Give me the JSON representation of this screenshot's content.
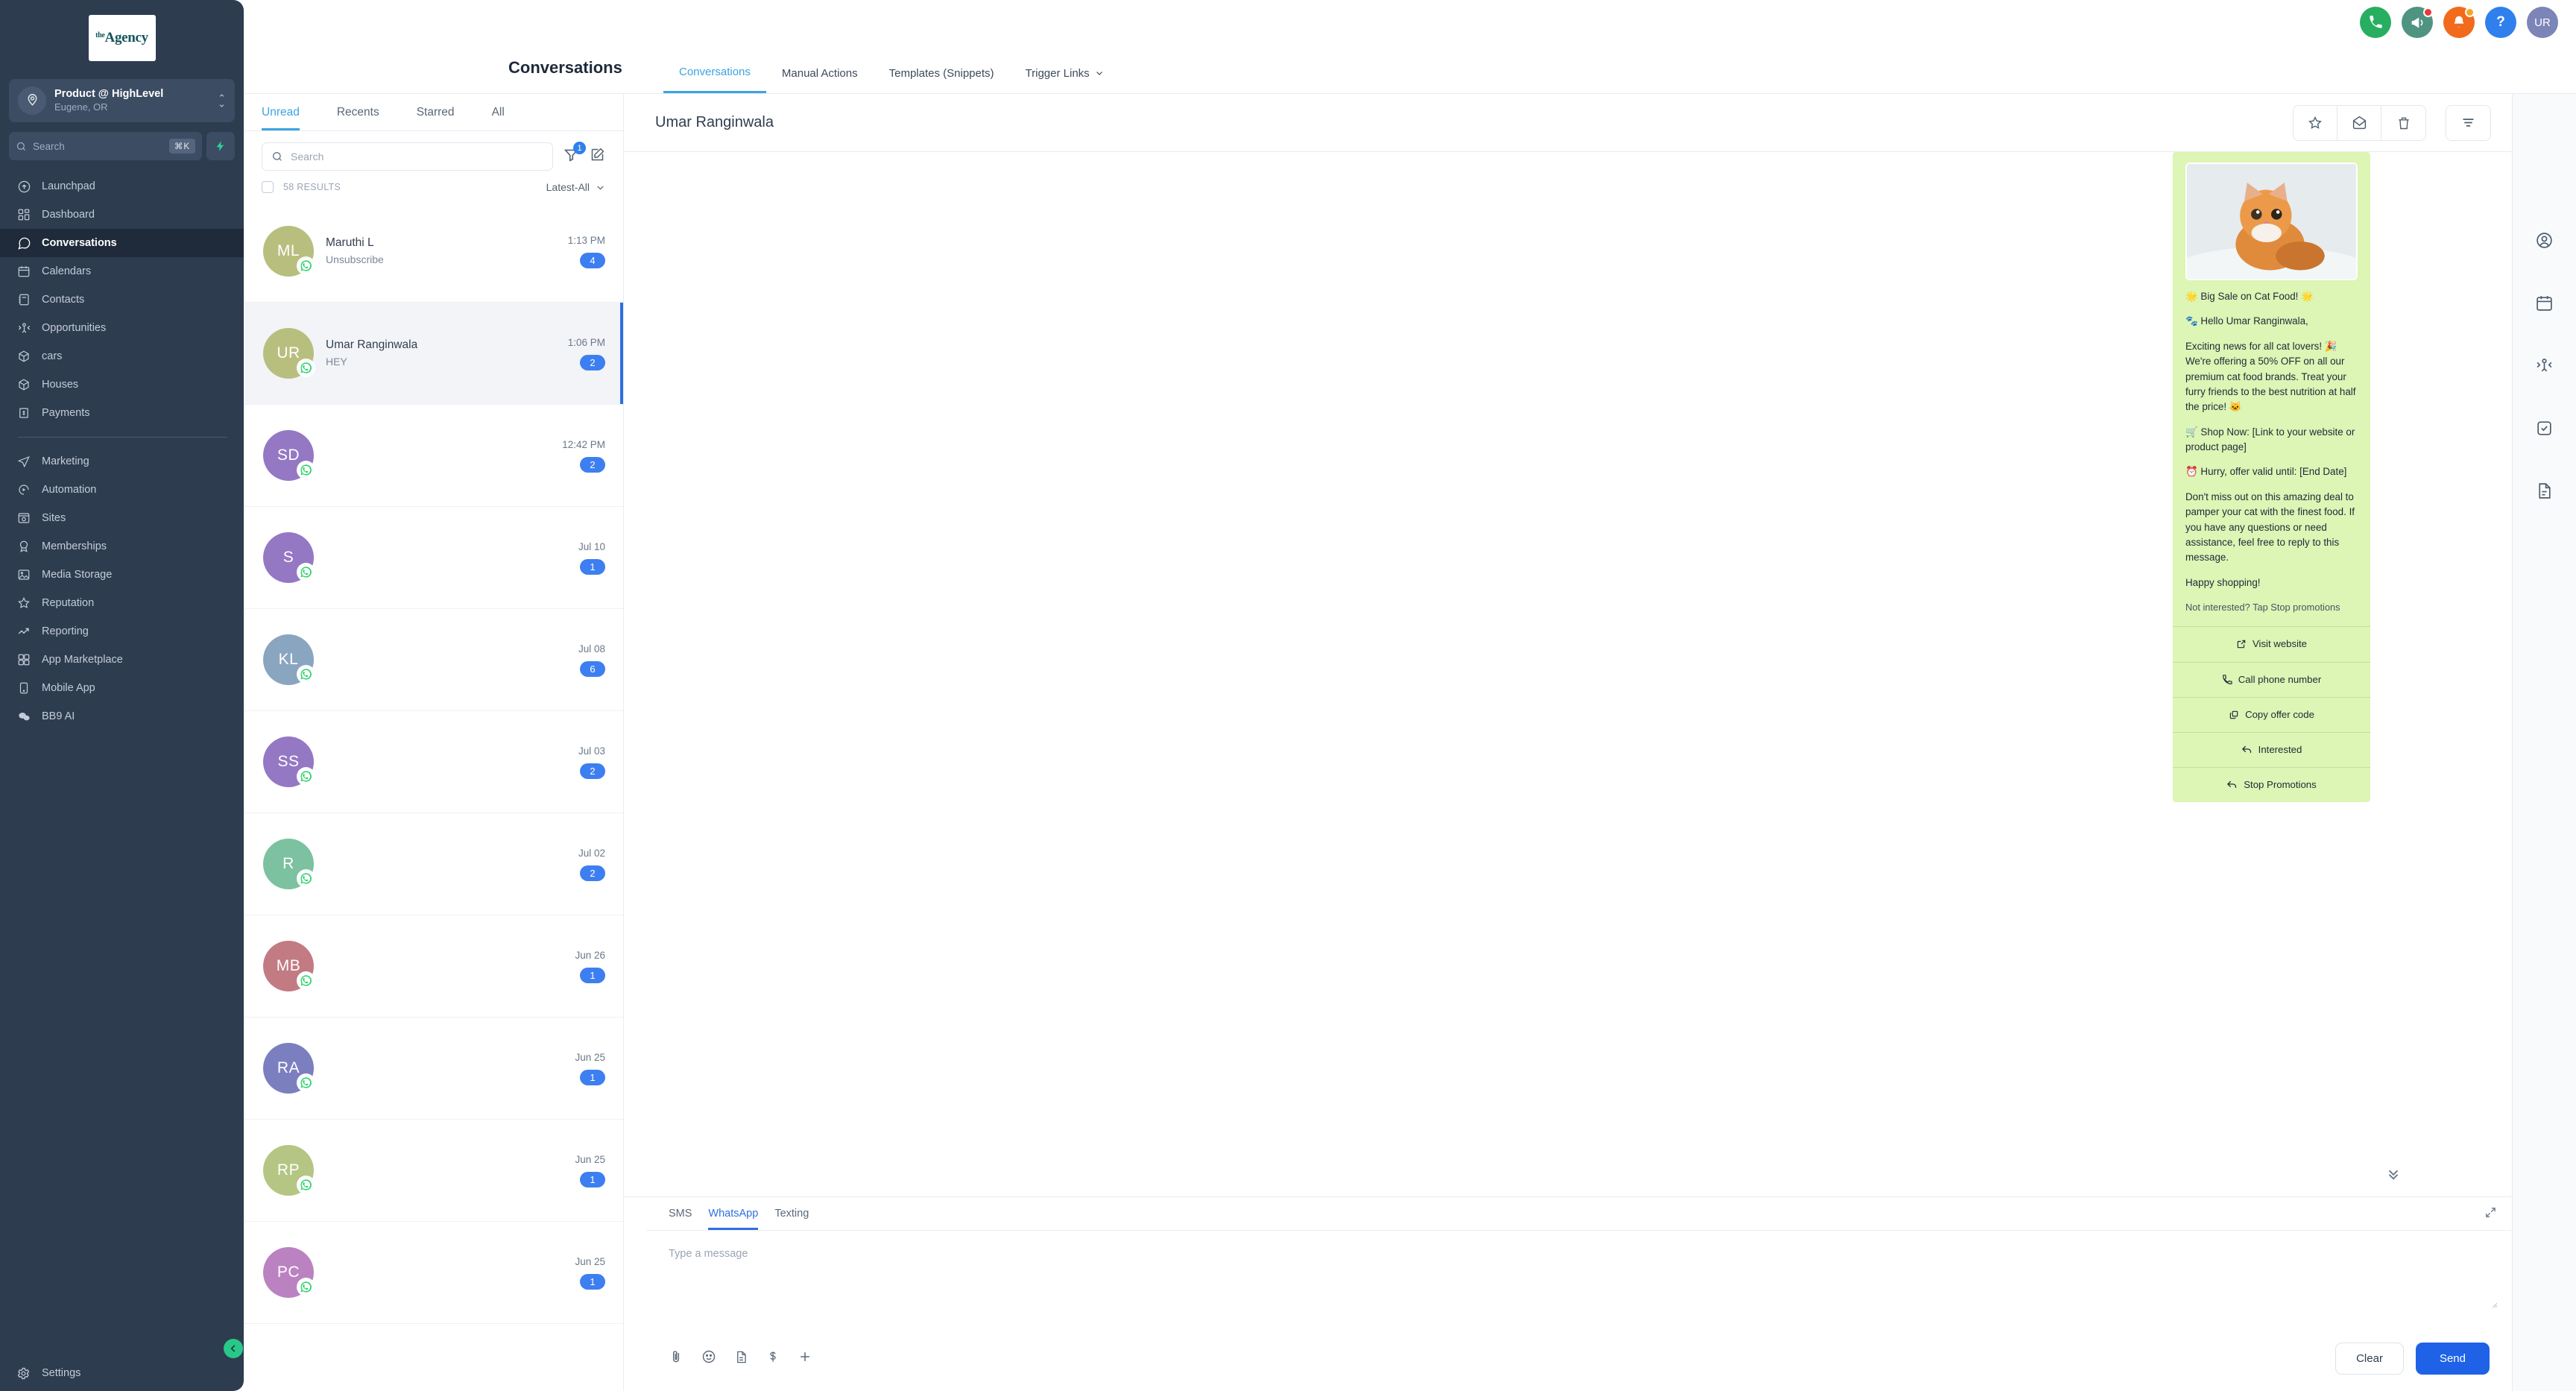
{
  "sidebar": {
    "logo": {
      "pre": "the",
      "main": "Agency"
    },
    "location": {
      "name": "Product @ HighLevel",
      "sub": "Eugene, OR"
    },
    "search": {
      "placeholder": "Search",
      "shortcut": "⌘K"
    },
    "items": [
      {
        "label": "Launchpad",
        "icon": "rocket-icon",
        "active": false
      },
      {
        "label": "Dashboard",
        "icon": "dashboard-icon",
        "active": false
      },
      {
        "label": "Conversations",
        "icon": "chat-icon",
        "active": true
      },
      {
        "label": "Calendars",
        "icon": "calendar-icon",
        "active": false
      },
      {
        "label": "Contacts",
        "icon": "contacts-icon",
        "active": false
      },
      {
        "label": "Opportunities",
        "icon": "opportunities-icon",
        "active": false
      },
      {
        "label": "cars",
        "icon": "box-icon",
        "active": false
      },
      {
        "label": "Houses",
        "icon": "box-icon",
        "active": false
      },
      {
        "label": "Payments",
        "icon": "payments-icon",
        "active": false
      }
    ],
    "items2": [
      {
        "label": "Marketing",
        "icon": "send-icon"
      },
      {
        "label": "Automation",
        "icon": "automation-icon"
      },
      {
        "label": "Sites",
        "icon": "sites-icon"
      },
      {
        "label": "Memberships",
        "icon": "badge-icon"
      },
      {
        "label": "Media Storage",
        "icon": "image-icon"
      },
      {
        "label": "Reputation",
        "icon": "star-icon"
      },
      {
        "label": "Reporting",
        "icon": "trend-icon"
      },
      {
        "label": "App Marketplace",
        "icon": "grid-icon"
      },
      {
        "label": "Mobile App",
        "icon": "phone-icon"
      },
      {
        "label": "BB9 AI",
        "icon": "bubbles-icon"
      }
    ],
    "settings": {
      "label": "Settings",
      "icon": "gear-icon"
    },
    "collapse": {
      "icon": "chevron-left-icon"
    }
  },
  "topbar": {
    "actions": [
      {
        "name": "call-button",
        "icon": "phone-icon",
        "color": "#27ae60",
        "badge": null
      },
      {
        "name": "announcements-button",
        "icon": "megaphone-icon",
        "color": "#4f9480",
        "badge": "#e8393b"
      },
      {
        "name": "notifications-button",
        "icon": "bell-icon",
        "color": "#f26a1b",
        "badge": "#f5a623"
      },
      {
        "name": "help-button",
        "icon": "question-icon",
        "color": "#2f80ed",
        "badge": null
      }
    ],
    "avatar": {
      "initials": "UR",
      "color": "#7c85b8"
    }
  },
  "pagehead": {
    "title": "Conversations",
    "tabs": [
      {
        "label": "Conversations",
        "active": true,
        "caret": false
      },
      {
        "label": "Manual Actions",
        "active": false,
        "caret": false
      },
      {
        "label": "Templates (Snippets)",
        "active": false,
        "caret": false
      },
      {
        "label": "Trigger Links",
        "active": false,
        "caret": true
      }
    ]
  },
  "conversations": {
    "tabs": [
      {
        "label": "Unread",
        "active": true
      },
      {
        "label": "Recents",
        "active": false
      },
      {
        "label": "Starred",
        "active": false
      },
      {
        "label": "All",
        "active": false
      }
    ],
    "search_placeholder": "Search",
    "filter_badge": "1",
    "results_label": "58 RESULTS",
    "sort_label": "Latest-All",
    "items": [
      {
        "initials": "ML",
        "color": "#b8bf7e",
        "name": "Maruthi L",
        "preview": "Unsubscribe",
        "time": "1:13 PM",
        "count": "4",
        "selected": false
      },
      {
        "initials": "UR",
        "color": "#b8bf7e",
        "name": "Umar Ranginwala",
        "preview": "HEY",
        "time": "1:06 PM",
        "count": "2",
        "selected": true
      },
      {
        "initials": "SD",
        "color": "#9578c4",
        "name": "",
        "preview": "",
        "time": "12:42 PM",
        "count": "2",
        "selected": false
      },
      {
        "initials": "S",
        "color": "#9578c4",
        "name": "",
        "preview": "",
        "time": "Jul 10",
        "count": "1",
        "selected": false
      },
      {
        "initials": "KL",
        "color": "#8aa5bf",
        "name": "",
        "preview": "",
        "time": "Jul 08",
        "count": "6",
        "selected": false
      },
      {
        "initials": "SS",
        "color": "#9578c4",
        "name": "",
        "preview": "",
        "time": "Jul 03",
        "count": "2",
        "selected": false
      },
      {
        "initials": "R",
        "color": "#7cc1a0",
        "name": "",
        "preview": "",
        "time": "Jul 02",
        "count": "2",
        "selected": false
      },
      {
        "initials": "MB",
        "color": "#c27b83",
        "name": "",
        "preview": "",
        "time": "Jun 26",
        "count": "1",
        "selected": false
      },
      {
        "initials": "RA",
        "color": "#7b7fc0",
        "name": "",
        "preview": "",
        "time": "Jun 25",
        "count": "1",
        "selected": false
      },
      {
        "initials": "RP",
        "color": "#b5c583",
        "name": "",
        "preview": "",
        "time": "Jun 25",
        "count": "1",
        "selected": false
      },
      {
        "initials": "PC",
        "color": "#bb82c2",
        "name": "",
        "preview": "",
        "time": "Jun 25",
        "count": "1",
        "selected": false
      }
    ]
  },
  "thread": {
    "contact_name": "Umar Ranginwala",
    "head_actions": [
      {
        "name": "star-button",
        "icon": "star-icon"
      },
      {
        "name": "mark-unread-button",
        "icon": "envelope-open-icon"
      },
      {
        "name": "delete-button",
        "icon": "trash-icon"
      },
      {
        "name": "filter-button",
        "icon": "filter-icon"
      }
    ],
    "message": {
      "image_alt": "orange kitten photo",
      "lines": [
        "🌟 Big Sale on Cat Food! 🌟",
        "🐾 Hello Umar Ranginwala,",
        "Exciting news for all cat lovers! 🎉 We're offering a 50% OFF on all our premium cat food brands. Treat your furry friends to the best nutrition at half the price! 🐱",
        "🛒 Shop Now: [Link to your website or product page]",
        "⏰ Hurry, offer valid until: [End Date]",
        "Don't miss out on this amazing deal to pamper your cat with the finest food. If you have any questions or need assistance, feel free to reply to this message.",
        "Happy shopping!"
      ],
      "optout": "Not interested? Tap Stop promotions",
      "ctas": [
        {
          "label": "Visit website",
          "icon": "external-link-icon"
        },
        {
          "label": "Call phone number",
          "icon": "phone-icon"
        },
        {
          "label": "Copy offer code",
          "icon": "copy-icon"
        },
        {
          "label": "Interested",
          "icon": "reply-icon"
        },
        {
          "label": "Stop Promotions",
          "icon": "reply-icon"
        }
      ]
    },
    "scroll_down_icon": "chevrons-down-icon"
  },
  "composer": {
    "tabs": [
      {
        "label": "SMS",
        "active": false
      },
      {
        "label": "WhatsApp",
        "active": true
      },
      {
        "label": "Texting",
        "active": false
      }
    ],
    "placeholder": "Type a message",
    "value": "",
    "icons": [
      {
        "name": "attachment-icon",
        "glyph": "attach"
      },
      {
        "name": "emoji-icon",
        "glyph": "emoji"
      },
      {
        "name": "snippet-icon",
        "glyph": "doc"
      },
      {
        "name": "payment-icon",
        "glyph": "dollar"
      },
      {
        "name": "add-icon",
        "glyph": "plus"
      }
    ],
    "clear_label": "Clear",
    "send_label": "Send"
  },
  "rightrail": {
    "items": [
      {
        "name": "contact-panel-icon",
        "label": "Contact"
      },
      {
        "name": "calendar-panel-icon",
        "label": "Appointments"
      },
      {
        "name": "opportunities-panel-icon",
        "label": "Opportunities"
      },
      {
        "name": "tasks-panel-icon",
        "label": "Tasks"
      },
      {
        "name": "documents-panel-icon",
        "label": "Documents"
      }
    ]
  },
  "colors": {
    "sidebar_bg": "#2e3c50",
    "accent_blue": "#3ba4e0",
    "send_blue": "#1f62e8",
    "badge_blue": "#3d7ff0",
    "bubble_green": "#ddf5b5",
    "collapse_green": "#28c88a"
  }
}
